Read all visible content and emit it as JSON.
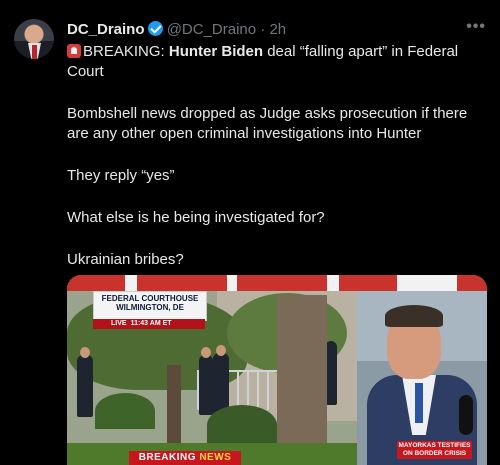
{
  "author": {
    "display_name": "DC_Draino",
    "handle": "@DC_Draino",
    "separator": "·",
    "time": "2h",
    "verified_color": "#1d9bf0"
  },
  "tweet": {
    "breaking_prefix": "BREAKING: ",
    "subject": "Hunter Biden",
    "headline_rest": " deal “falling apart” in Federal Court",
    "paragraphs": [
      "Bombshell news dropped as Judge asks prosecution if there are any other open criminal investigations into Hunter",
      "They reply “yes”",
      "What else is he being investigated for?",
      "Ukrainian bribes?"
    ]
  },
  "more_icon": "more-horizontal-icon",
  "media": {
    "location_line1": "FEDERAL COURTHOUSE",
    "location_line2": "WILMINGTON, DE",
    "live_label": "LIVE",
    "live_time": "11:43 AM ET",
    "breaking_label": "BREAKING",
    "breaking_news_word": "NEWS",
    "side_banner_line1": "MAYORKAS TESTIFIES",
    "side_banner_line2": "ON BORDER CRISIS"
  }
}
